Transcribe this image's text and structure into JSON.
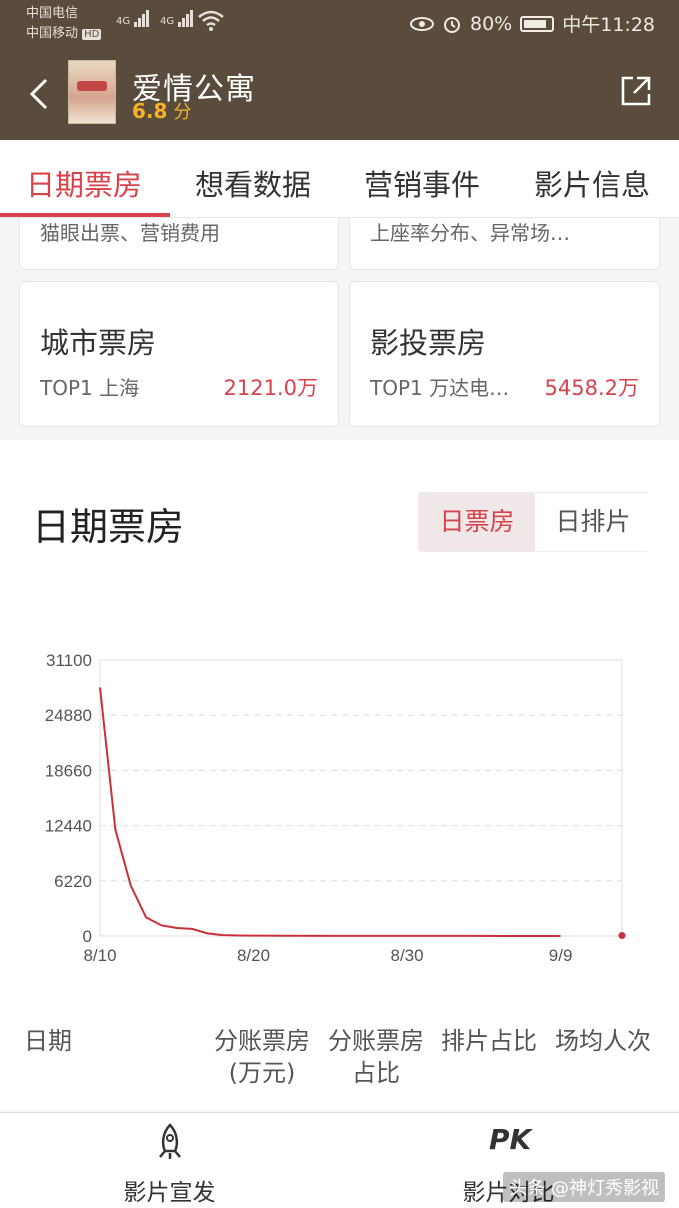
{
  "status_bar": {
    "carrier1": "中国电信",
    "carrier2": "中国移动",
    "hd": "HD",
    "net1": "4G",
    "net2": "4G",
    "battery": "80%",
    "time": "中午11:28"
  },
  "header": {
    "title": "爱情公寓",
    "score": "6.8",
    "score_unit": "分"
  },
  "tabs": [
    "日期票房",
    "想看数据",
    "营销事件",
    "影片信息"
  ],
  "cards": {
    "partial_left_sub": "猫眼出票、营销费用",
    "partial_right_sub": "上座率分布、异常场…",
    "city": {
      "title": "城市票房",
      "sub": "TOP1 上海",
      "value": "2121.0万"
    },
    "invest": {
      "title": "影投票房",
      "sub": "TOP1 万达电…",
      "value": "5458.2万"
    }
  },
  "section": {
    "title": "日期票房",
    "toggle_active": "日票房",
    "toggle_inactive": "日排片"
  },
  "chart_data": {
    "type": "line",
    "yticks": [
      "31100",
      "24880",
      "18660",
      "12440",
      "6220",
      "0"
    ],
    "xticks": [
      "8/10",
      "8/20",
      "8/30",
      "9/9"
    ],
    "ylim": [
      0,
      31100
    ],
    "x": [
      "8/10",
      "8/11",
      "8/12",
      "8/13",
      "8/14",
      "8/15",
      "8/16",
      "8/17",
      "8/18",
      "8/19",
      "8/20",
      "8/22",
      "8/25",
      "8/28",
      "8/31",
      "9/3",
      "9/6",
      "9/9"
    ],
    "values": [
      28000,
      12000,
      5700,
      2100,
      1200,
      900,
      800,
      300,
      100,
      60,
      40,
      30,
      20,
      15,
      10,
      8,
      5,
      3
    ],
    "last_point_x": "9/13",
    "last_point_value": 50,
    "series_color": "#c8313a",
    "grid": true
  },
  "table_header": {
    "col1": "日期",
    "col2a": "分账票房",
    "col2b": "(万元)",
    "col3a": "分账票房",
    "col3b": "占比",
    "col4": "排片占比",
    "col5": "场均人次"
  },
  "bottom_nav": {
    "left_label": "影片宣发",
    "right_label": "影片对比",
    "right_icon_text": "PK"
  },
  "watermark": "头条 @神灯秀影视"
}
